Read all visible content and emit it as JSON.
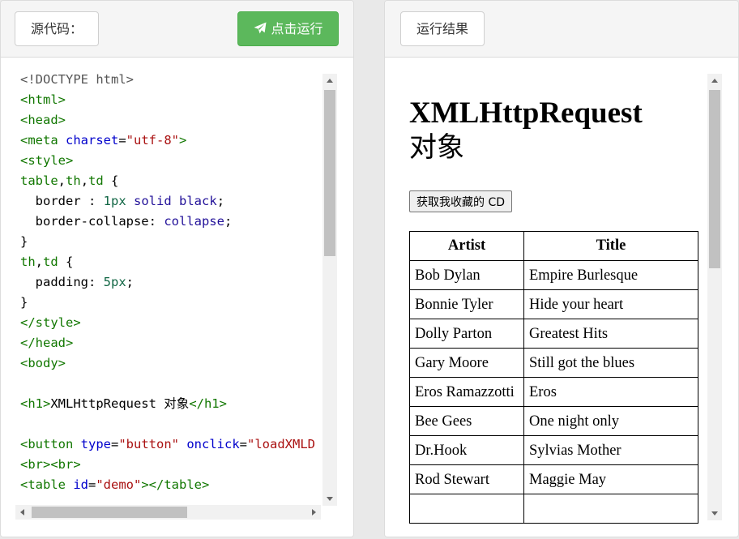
{
  "left_panel": {
    "source_label": "源代码：",
    "run_button_label": "点击运行"
  },
  "right_panel": {
    "result_label": "运行结果"
  },
  "code_lines": [
    [
      {
        "c": "meta",
        "t": "<!DOCTYPE html>"
      }
    ],
    [
      {
        "c": "tag",
        "t": "<html>"
      }
    ],
    [
      {
        "c": "tag",
        "t": "<head>"
      }
    ],
    [
      {
        "c": "tag",
        "t": "<meta "
      },
      {
        "c": "attr",
        "t": "charset"
      },
      {
        "c": "prop",
        "t": "="
      },
      {
        "c": "str",
        "t": "\"utf-8\""
      },
      {
        "c": "tag",
        "t": ">"
      }
    ],
    [
      {
        "c": "tag",
        "t": "<style>"
      }
    ],
    [
      {
        "c": "tag",
        "t": "table"
      },
      {
        "c": "prop",
        "t": ","
      },
      {
        "c": "tag",
        "t": "th"
      },
      {
        "c": "prop",
        "t": ","
      },
      {
        "c": "tag",
        "t": "td"
      },
      {
        "c": "prop",
        "t": " {"
      }
    ],
    [
      {
        "c": "prop",
        "t": "  border : "
      },
      {
        "c": "num",
        "t": "1px"
      },
      {
        "c": "prop",
        "t": " "
      },
      {
        "c": "kw",
        "t": "solid"
      },
      {
        "c": "prop",
        "t": " "
      },
      {
        "c": "kw",
        "t": "black"
      },
      {
        "c": "prop",
        "t": ";"
      }
    ],
    [
      {
        "c": "prop",
        "t": "  border-collapse: "
      },
      {
        "c": "kw",
        "t": "collapse"
      },
      {
        "c": "prop",
        "t": ";"
      }
    ],
    [
      {
        "c": "prop",
        "t": "}"
      }
    ],
    [
      {
        "c": "tag",
        "t": "th"
      },
      {
        "c": "prop",
        "t": ","
      },
      {
        "c": "tag",
        "t": "td"
      },
      {
        "c": "prop",
        "t": " {"
      }
    ],
    [
      {
        "c": "prop",
        "t": "  padding: "
      },
      {
        "c": "num",
        "t": "5px"
      },
      {
        "c": "prop",
        "t": ";"
      }
    ],
    [
      {
        "c": "prop",
        "t": "}"
      }
    ],
    [
      {
        "c": "tag",
        "t": "</style>"
      }
    ],
    [
      {
        "c": "tag",
        "t": "</head>"
      }
    ],
    [
      {
        "c": "tag",
        "t": "<body>"
      }
    ],
    [
      {
        "c": "prop",
        "t": ""
      }
    ],
    [
      {
        "c": "tag",
        "t": "<h1>"
      },
      {
        "c": "prop",
        "t": "XMLHttpRequest 对象"
      },
      {
        "c": "tag",
        "t": "</h1>"
      }
    ],
    [
      {
        "c": "prop",
        "t": ""
      }
    ],
    [
      {
        "c": "tag",
        "t": "<button "
      },
      {
        "c": "attr",
        "t": "type"
      },
      {
        "c": "prop",
        "t": "="
      },
      {
        "c": "str",
        "t": "\"button\""
      },
      {
        "c": "prop",
        "t": " "
      },
      {
        "c": "attr",
        "t": "onclick"
      },
      {
        "c": "prop",
        "t": "="
      },
      {
        "c": "str",
        "t": "\"loadXMLD"
      }
    ],
    [
      {
        "c": "tag",
        "t": "<br><br>"
      }
    ],
    [
      {
        "c": "tag",
        "t": "<table "
      },
      {
        "c": "attr",
        "t": "id"
      },
      {
        "c": "prop",
        "t": "="
      },
      {
        "c": "str",
        "t": "\"demo\""
      },
      {
        "c": "tag",
        "t": "></table>"
      }
    ]
  ],
  "result": {
    "title_latin": "XMLHttpRequest",
    "title_cjk": "对象",
    "fetch_button_label": "获取我收藏的 CD",
    "table_headers": [
      "Artist",
      "Title"
    ],
    "table_rows": [
      [
        "Bob Dylan",
        "Empire Burlesque"
      ],
      [
        "Bonnie Tyler",
        "Hide your heart"
      ],
      [
        "Dolly Parton",
        "Greatest Hits"
      ],
      [
        "Gary Moore",
        "Still got the blues"
      ],
      [
        "Eros Ramazzotti",
        "Eros"
      ],
      [
        "Bee Gees",
        "One night only"
      ],
      [
        "Dr.Hook",
        "Sylvias Mother"
      ],
      [
        "Rod Stewart",
        "Maggie May"
      ],
      [
        "",
        ""
      ]
    ]
  },
  "colors": {
    "run_button": "#5cb85c",
    "code_tag": "#117700",
    "code_attr": "#0000cc",
    "code_string": "#aa1111"
  },
  "icons": {
    "run": "paper-plane-icon"
  }
}
